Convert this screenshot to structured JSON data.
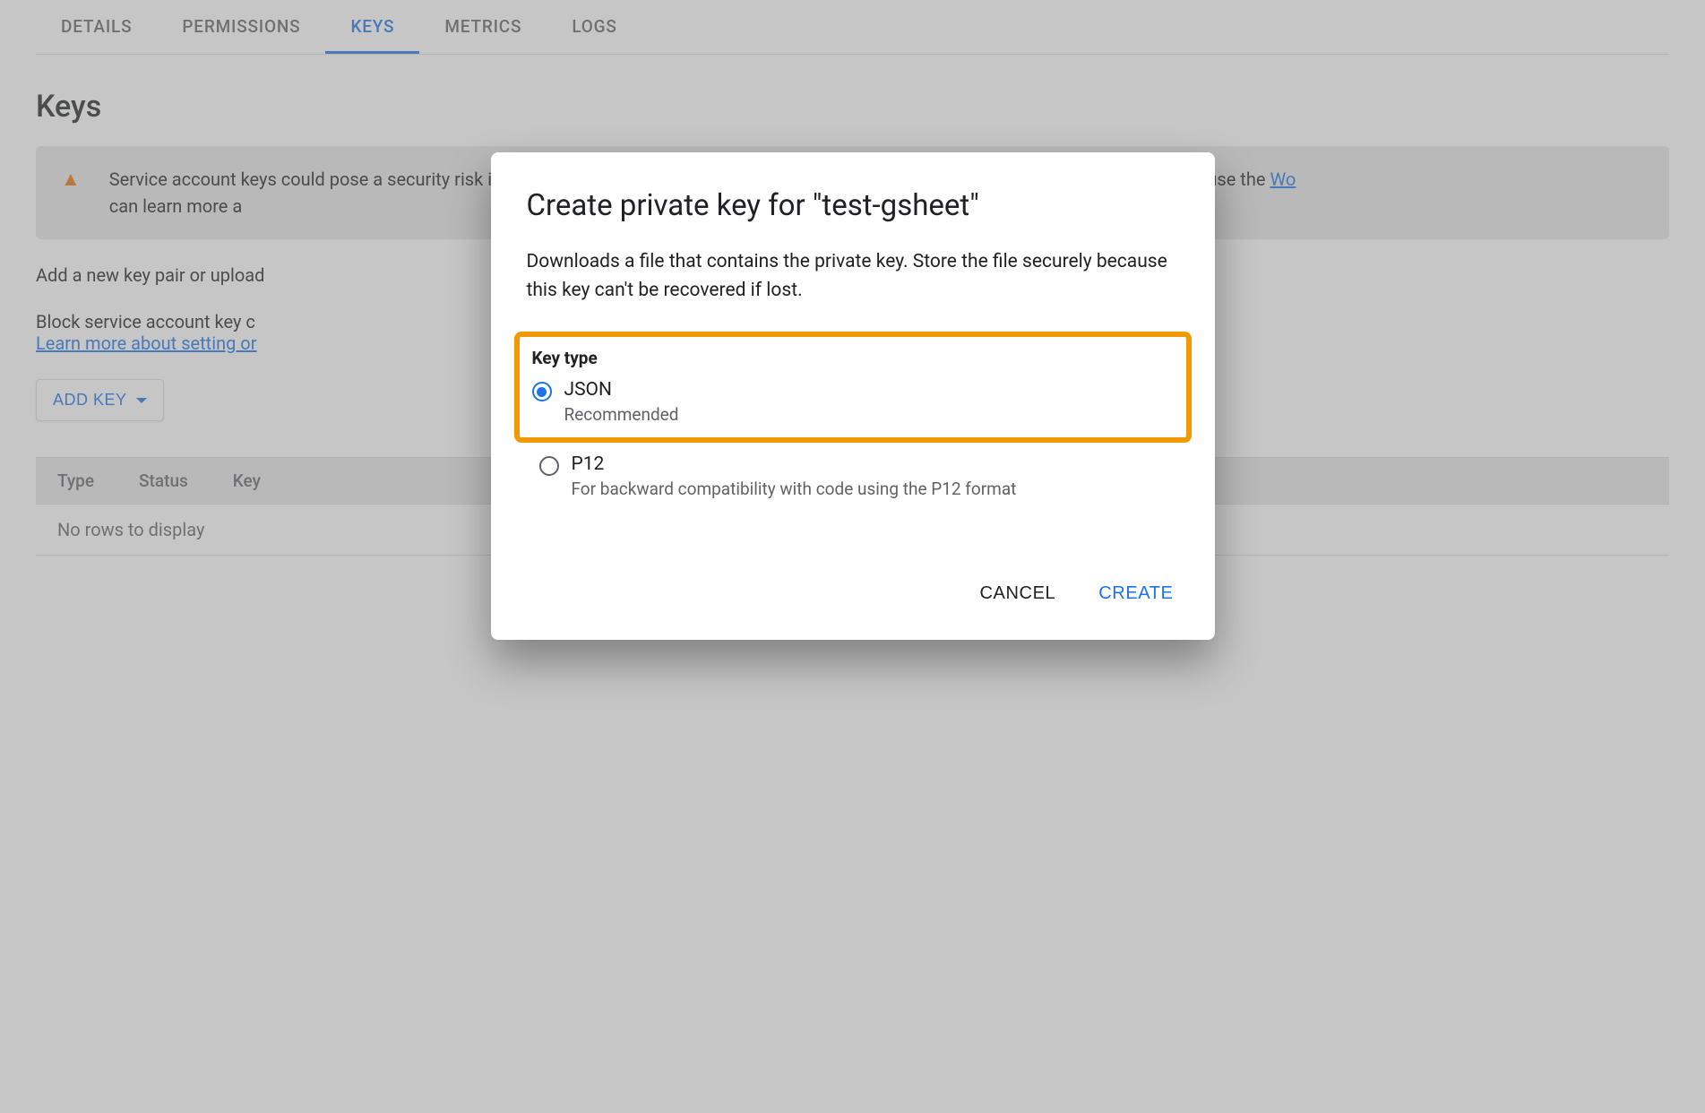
{
  "tabs": {
    "details": "DETAILS",
    "permissions": "PERMISSIONS",
    "keys": "KEYS",
    "metrics": "METRICS",
    "logs": "LOGS"
  },
  "page": {
    "title": "Keys",
    "warning_text_1": "Service account keys could pose a security risk if compromised. We recommend you avoid downloading service account keys and instead use the ",
    "warning_link": "Wo",
    "warning_text_2": " can learn more a",
    "add_pair_text": "Add a new key pair or upload",
    "block_text": "Block service account key c",
    "learn_more_link": "Learn more about setting or",
    "add_key_btn": "ADD KEY"
  },
  "table": {
    "col_type": "Type",
    "col_status": "Status",
    "col_key": "Key",
    "empty": "No rows to display"
  },
  "dialog": {
    "title": "Create private key for \"test-gsheet\"",
    "desc": "Downloads a file that contains the private key. Store the file securely because this key can't be recovered if lost.",
    "key_type_label": "Key type",
    "json_label": "JSON",
    "json_sub": "Recommended",
    "p12_label": "P12",
    "p12_sub": "For backward compatibility with code using the P12 format",
    "cancel": "CANCEL",
    "create": "CREATE"
  }
}
